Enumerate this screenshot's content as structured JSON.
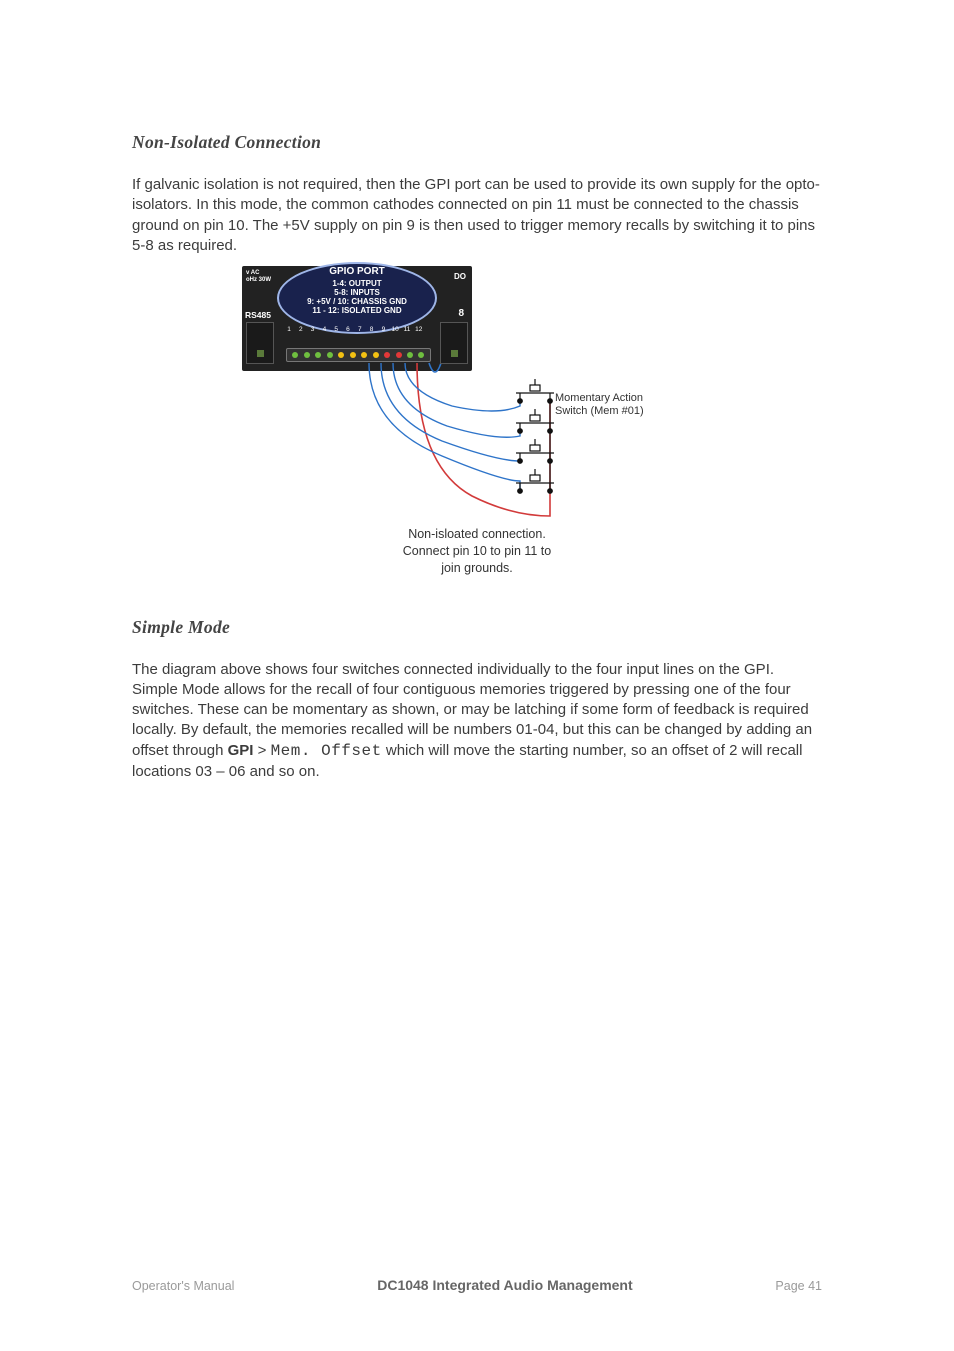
{
  "section1": {
    "heading": "Non-Isolated Connection",
    "para": "If galvanic isolation is not required, then the GPI port can be used to provide its own supply for the opto-isolators.  In this mode, the common cathodes connected on pin 11 must be connected to the chassis ground on pin 10.  The +5V supply on pin 9 is then used to trigger memory recalls by switching it to pins 5-8 as required."
  },
  "diagram": {
    "panel": {
      "ac_line1": "v AC",
      "ac_line2": "oHz 30W",
      "gpio_title": "GPIO PORT",
      "gpio_l1": "1-4: OUTPUT",
      "gpio_l2": "5-8: INPUTS",
      "gpio_l3": "9: +5V / 10: CHASSIS GND",
      "gpio_l4": "11 - 12:  ISOLATED GND",
      "rs485": "RS485",
      "do": "DO",
      "eight": "8",
      "pins": [
        "1",
        "2",
        "3",
        "4",
        "5",
        "6",
        "7",
        "8",
        "9",
        "10",
        "11",
        "12"
      ],
      "dot_colors": [
        "#6fbf3f",
        "#6fbf3f",
        "#6fbf3f",
        "#6fbf3f",
        "#f3c112",
        "#f3c112",
        "#f3c112",
        "#f3c112",
        "#e33838",
        "#e33838",
        "#6fbf3f",
        "#6fbf3f"
      ]
    },
    "switch_label_l1": "Momentary Action",
    "switch_label_l2": "Switch (Mem #01)",
    "caption_l1": "Non-isloated connection.",
    "caption_l2": "Connect pin 10 to pin 11 to",
    "caption_l3": "join grounds."
  },
  "section2": {
    "heading": "Simple Mode",
    "para_pre": "The diagram above shows four switches connected individually to the four input lines on the GPI.  Simple Mode allows for the recall of four contiguous memories triggered by pressing one of the four switches.  These can be momentary as shown, or may be latching if some form of feedback is required locally.  By default, the memories recalled will be numbers 01-04, but this can be changed by adding an offset through ",
    "gpi": "GPI",
    "gt": " > ",
    "lcd": "Mem. Offset",
    "para_post": " which will move the starting number, so an offset of 2 will recall locations 03 – 06 and so on."
  },
  "footer": {
    "left": "Operator's Manual",
    "center": "DC1048 Integrated Audio Management",
    "page_label": "Page ",
    "page_num": "41"
  }
}
